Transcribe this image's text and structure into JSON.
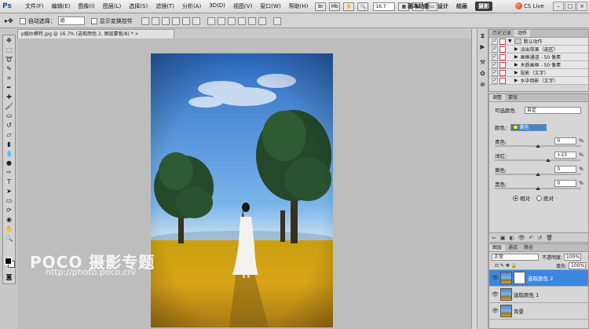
{
  "app": {
    "logo": "Ps"
  },
  "menubar": {
    "items": [
      "文件(F)",
      "编辑(E)",
      "图像(I)",
      "图层(L)",
      "选择(S)",
      "滤镜(T)",
      "分析(A)",
      "3D(D)",
      "视图(V)",
      "窗口(W)",
      "帮助(H)"
    ],
    "zoom": "16.7",
    "workspaces": [
      "基本功能",
      "设计",
      "绘画",
      "摄影"
    ],
    "active_workspace": "摄影",
    "cs_live": "CS Live",
    "win_buttons": [
      "–",
      "□",
      "×"
    ]
  },
  "options": {
    "auto_select_label": "自动选择：",
    "auto_select_value": "组",
    "show_transform_label": "显示变换控件"
  },
  "document": {
    "tab_title": "p婚纱模特.jpg @ 16.7% (选取颜色 2, 图层蒙版/8) *  ×"
  },
  "watermark": {
    "line1": "POCO 摄影专题",
    "line2": "http://photo.poco.cn/"
  },
  "actions_panel": {
    "tabs": [
      "历史记录",
      "动作"
    ],
    "active_tab": "动作",
    "rows": [
      {
        "label": "默认动作",
        "indent": 0
      },
      {
        "label": "淡出效果（选区）",
        "indent": 1
      },
      {
        "label": "画框通道 - 50 像素",
        "indent": 1
      },
      {
        "label": "木质画框 - 50 像素",
        "indent": 1
      },
      {
        "label": "投影（文字）",
        "indent": 1
      },
      {
        "label": "水中倒影（文字）",
        "indent": 1
      }
    ]
  },
  "adjust_panel": {
    "tabs": [
      "调整",
      "蒙版"
    ],
    "active_tab": "调整",
    "title": "可选颜色",
    "preset": "自定",
    "color_label": "颜色：",
    "color_value": "黄色",
    "color_swatch": "#ffff00",
    "sliders": [
      {
        "label": "青色:",
        "value": "0",
        "level": 0
      },
      {
        "label": "洋红:",
        "value": "+23",
        "level": 23
      },
      {
        "label": "黄色:",
        "value": "0",
        "level": 0
      },
      {
        "label": "黑色:",
        "value": "0",
        "level": 0
      }
    ],
    "method_relative": "相对",
    "method_absolute": "绝对",
    "method_selected": "相对"
  },
  "layers_panel": {
    "tabs": [
      "图层",
      "通道",
      "路径"
    ],
    "active_tab": "图层",
    "blend_mode": "正常",
    "opacity_label": "不透明度:",
    "opacity": "100%",
    "fill_label": "填充:",
    "fill": "100%",
    "layers": [
      {
        "name": "选取颜色 2",
        "selected": true,
        "mask": true
      },
      {
        "name": "选取颜色 1",
        "selected": false,
        "mask": false
      },
      {
        "name": "背景",
        "selected": false,
        "mask": false
      }
    ]
  }
}
